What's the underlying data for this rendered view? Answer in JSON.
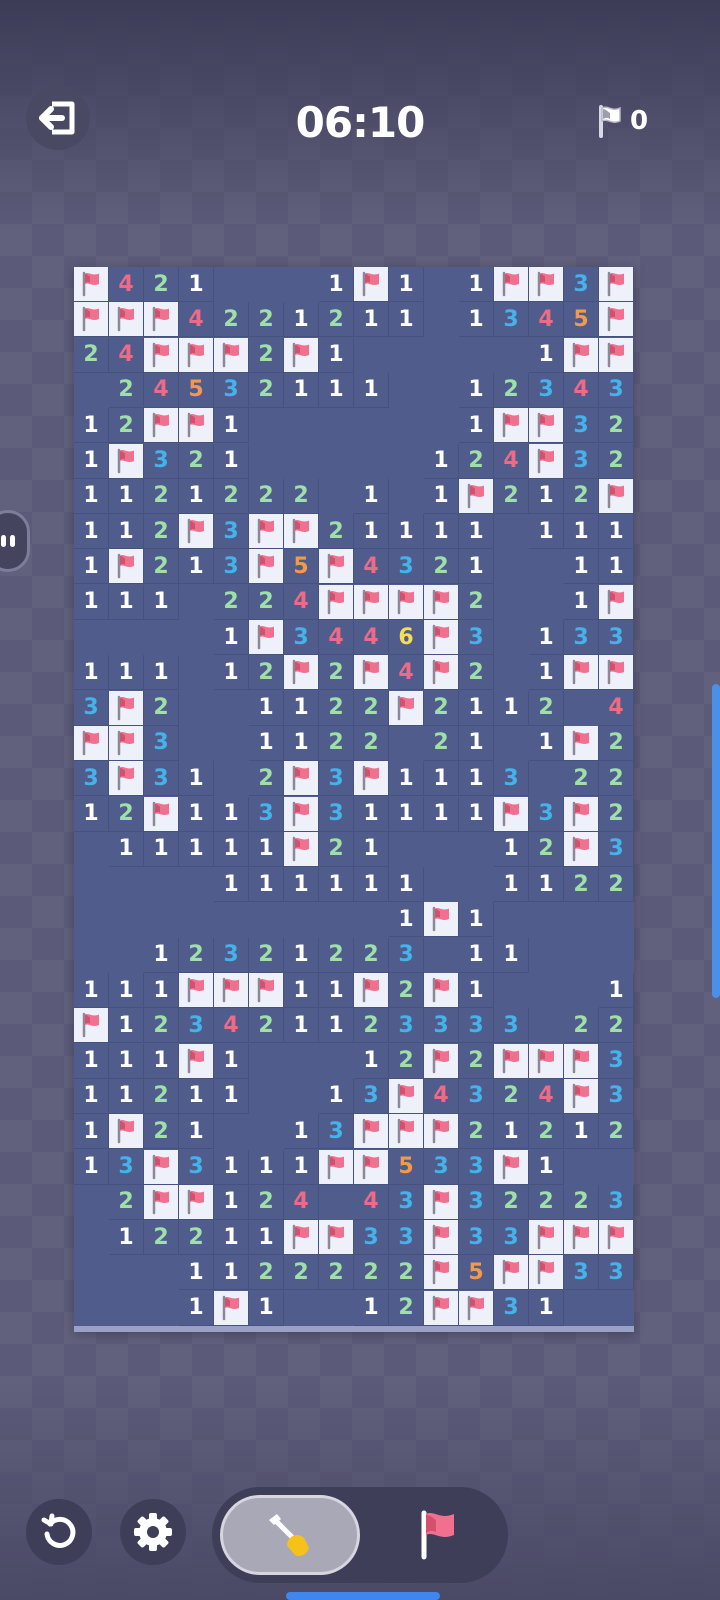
{
  "header": {
    "timer": "06:10",
    "flags_placed": "0"
  },
  "icons": {
    "exit": "exit-icon",
    "flag_counter": "flag-outline-icon",
    "restart": "restart-icon",
    "settings": "gear-icon",
    "dig": "shovel-icon",
    "flag_mode": "flag-icon",
    "cell_flag": "flag-icon"
  },
  "colors": {
    "number_1": "#ffffff",
    "number_2": "#9ee0a8",
    "number_3": "#45b3ea",
    "number_4": "#ee6a86",
    "number_5": "#f29a4a",
    "number_6": "#f4df52",
    "flag": "#f0708f",
    "board": "#4f5c8c",
    "accent": "#3f86ee"
  },
  "mode_toggle": {
    "selected": "dig"
  },
  "board": {
    "cols": 16,
    "rows": [
      "F421   1F1 1FF3F",
      "FFF4221211 1345F",
      "24FFF2F1     1FF3",
      " 24532111  12343F2",
      "12FF1      1FF322",
      "1F321     124F32F",
      "1121222 1 1F212F2",
      "112F3FF21111 111",
      "1F213F5F4321  11",
      "111 224FFFF2  1F",
      "    1F3446F3 133",
      "111 12F2F4F2 1FF",
      "3F2  1122F2112 4F",
      "FF3  1122 21 1F21",
      "3F31 2F3F1113 22 ",
      "12F113F31111F3F21",
      " 11111F21   12F3F2",
      "    111111  1122F",
      "         1F1    11",
      "  12321223 11   11",
      "111FFF11F2F1   1F",
      "F123421123333 221",
      "111F1   12F2FFF31",
      "11211  13F4324F3F",
      "1F21  13FFF212121",
      "13F3111FF533F1   ",
      " 2FF124 43F322232",
      " 12211FF33F33FFF",
      "   1122222F5FF332",
      "   1F1  12FF31  "
    ]
  }
}
